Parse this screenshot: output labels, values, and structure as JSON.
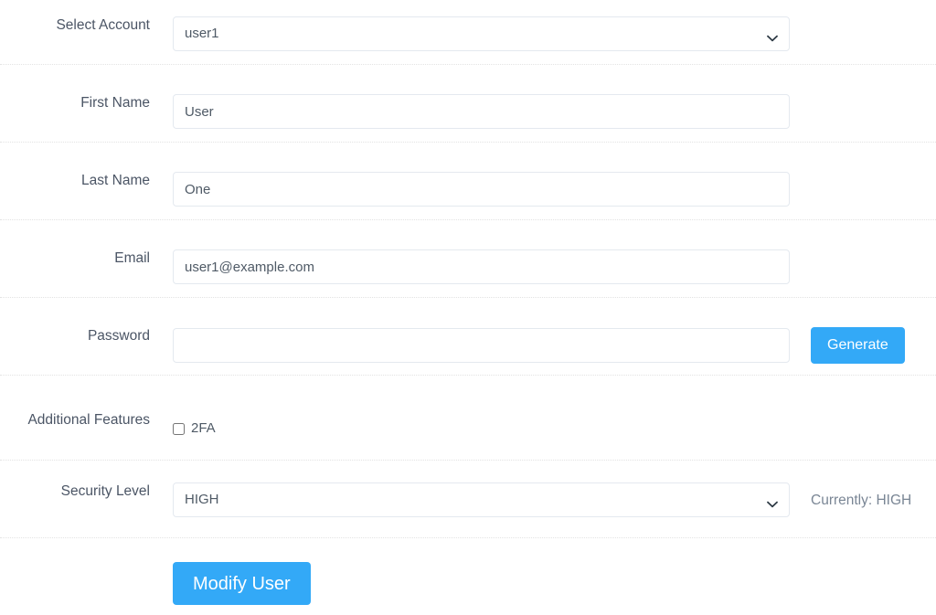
{
  "form": {
    "rows": [
      {
        "label": "Select Account",
        "type": "select",
        "value": "user1",
        "options": [
          "user1"
        ]
      },
      {
        "label": "First Name",
        "type": "text",
        "value": "User",
        "placeholder": ""
      },
      {
        "label": "Last Name",
        "type": "text",
        "value": "One",
        "placeholder": ""
      },
      {
        "label": "Email",
        "type": "text",
        "value": "user1@example.com",
        "placeholder": ""
      },
      {
        "label": "Password",
        "type": "password",
        "value": "",
        "placeholder": "",
        "action_label": "Generate"
      },
      {
        "label": "Additional Features",
        "type": "checkbox",
        "checkbox_label": "2FA",
        "checked": false
      },
      {
        "label": "Security Level",
        "type": "select",
        "value": "HIGH",
        "options": [
          "HIGH"
        ],
        "note": "Currently: HIGH"
      }
    ],
    "submit_label": "Modify User"
  },
  "icons": {
    "chevron_down": "chevron-down-icon"
  },
  "colors": {
    "accent": "#33a9f7",
    "label_text": "#4b5565",
    "field_text": "#4f5a66",
    "note_text": "#7a8695",
    "border": "#e4e9ef",
    "divider": "#e3e3e3",
    "background": "#ffffff"
  }
}
